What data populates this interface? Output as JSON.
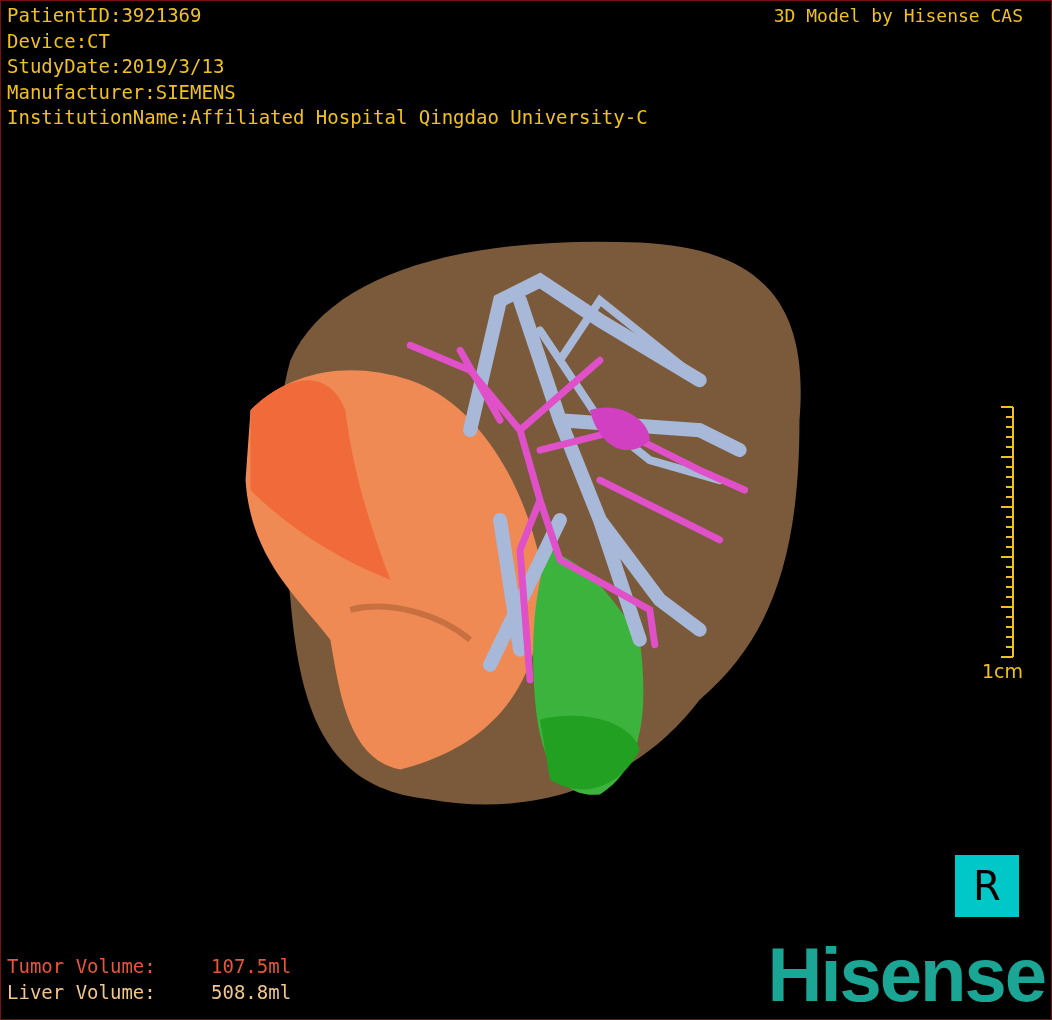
{
  "info_lines": [
    "PatientID:3921369",
    "Device:CT",
    "StudyDate:2019/3/13",
    "Manufacturer:SIEMENS",
    "InstitutionName:Affiliated Hospital Qingdao University-C"
  ],
  "title": "3D Model by Hisense CAS",
  "scale": {
    "label": "1cm"
  },
  "orientation": "R",
  "volumes": [
    {
      "label": "Tumor Volume:",
      "value": "107.5ml",
      "color": "#e8553a"
    },
    {
      "label": "Liver Volume:",
      "value": "508.8ml",
      "color": "#f2c58a"
    }
  ],
  "logo": "Hisense"
}
